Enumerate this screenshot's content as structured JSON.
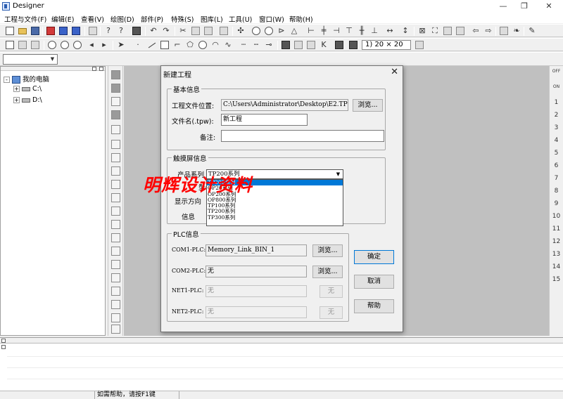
{
  "app": {
    "title": "Designer"
  },
  "window_controls": {
    "minimize": "—",
    "restore": "❐",
    "close": "✕"
  },
  "menu": [
    "工程与文件(F)",
    "编辑(E)",
    "查看(V)",
    "绘图(D)",
    "部件(P)",
    "特殊(S)",
    "图库(L)",
    "工具(U)",
    "窗口(W)",
    "帮助(H)"
  ],
  "toolbar": {
    "scale": "1) 20 × 20"
  },
  "tree": {
    "root": "我的电脑",
    "items": [
      "C:\\",
      "D:\\"
    ],
    "expander": "+",
    "root_expander": "-"
  },
  "right_strip": {
    "off": "OFF",
    "on": "ON",
    "numbers": [
      "1",
      "2",
      "3",
      "4",
      "5",
      "6",
      "7",
      "8",
      "9",
      "10",
      "11",
      "12",
      "13",
      "14",
      "15"
    ]
  },
  "status": {
    "help": "如需帮助，请按F1键"
  },
  "dialog": {
    "title": "新建工程",
    "close": "✕",
    "basic": {
      "group": "基本信息",
      "path_label": "工程文件位置:",
      "path_value": "C:\\Users\\Administrator\\Desktop\\E2.TPDe",
      "browse": "浏览...",
      "name_label": "文件名(.tpw):",
      "name_value": "新工程",
      "note_label": "备注:",
      "note_value": ""
    },
    "touch": {
      "group": "触摸屏信息",
      "series_label": "产品系列",
      "series_value": "TP200系列",
      "model_label": "型号",
      "orientation_label": "显示方向",
      "info_label": "信息",
      "options": [
        "TP200系列",
        "OP20系列",
        "OP200系列",
        "OP800系列",
        "TP100系列",
        "TP200系列",
        "TP300系列"
      ],
      "selected_index": 0
    },
    "plc": {
      "group": "PLC信息",
      "com1_label": "COM1-PLC:",
      "com1_value": "Memory_Link_BIN_1",
      "com2_label": "COM2-PLC:",
      "com2_value": "无",
      "net1_label": "NET1-PLC:",
      "net1_value": "无",
      "net2_label": "NET2-PLC:",
      "net2_value": "无",
      "browse": "浏览...",
      "none_btn": "无"
    },
    "buttons": {
      "ok": "确定",
      "cancel": "取消",
      "help": "帮助"
    }
  },
  "watermark": "明辉设计资料"
}
